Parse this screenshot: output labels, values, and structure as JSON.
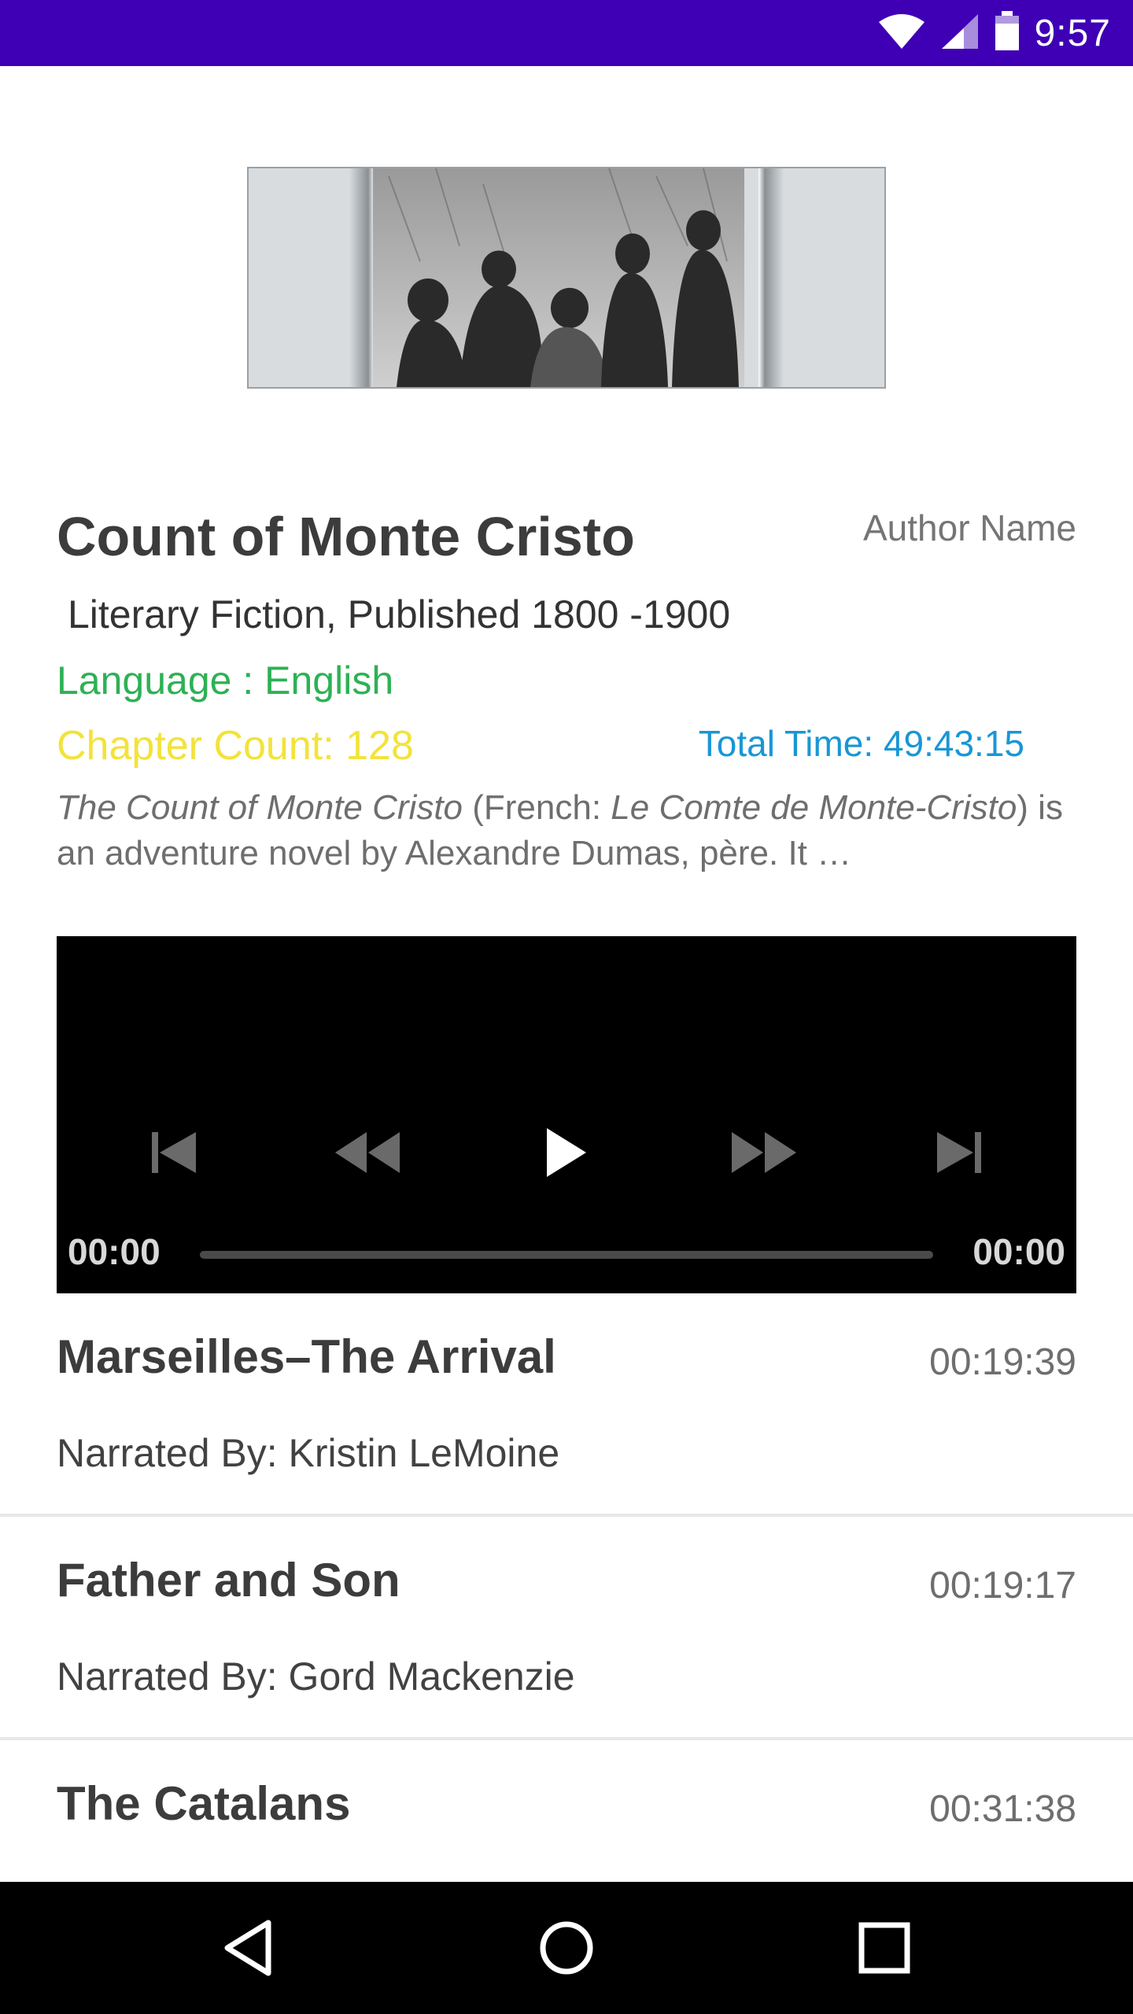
{
  "status_bar": {
    "time": "9:57",
    "icons": [
      "wifi-icon",
      "signal-icon",
      "battery-icon"
    ]
  },
  "book": {
    "title": "Count of Monte Cristo",
    "author": "Author Name",
    "genre_line": "Literary Fiction, Published 1800 -1900",
    "language": "Language : English",
    "chapter_count": "Chapter Count: 128",
    "total_time": "Total Time: 49:43:15",
    "description": {
      "italic_1": "The Count of Monte Cristo",
      "text_1": " (French: ",
      "italic_2": "Le Comte de Monte-Cristo",
      "text_2": ") is an adventure novel by Alexandre Dumas, père. It …"
    }
  },
  "player": {
    "elapsed": "00:00",
    "duration": "00:00",
    "progress": 0,
    "controls": [
      "skip-previous-icon",
      "rewind-icon",
      "play-icon",
      "fast-forward-icon",
      "skip-next-icon"
    ]
  },
  "chapters": [
    {
      "title": "Marseilles–The Arrival",
      "duration": "00:19:39",
      "narrator": "Narrated By: Kristin LeMoine"
    },
    {
      "title": "Father and Son",
      "duration": "00:19:17",
      "narrator": "Narrated By: Gord Mackenzie"
    },
    {
      "title": "The Catalans",
      "duration": "00:31:38",
      "narrator": ""
    }
  ],
  "colors": {
    "status_bar": "#3f00b5",
    "language": "#2db155",
    "chapter_count": "#f3e33a",
    "total_time": "#1996d6"
  },
  "nav_bar": {
    "buttons": [
      "back-icon",
      "home-icon",
      "recents-icon"
    ]
  }
}
